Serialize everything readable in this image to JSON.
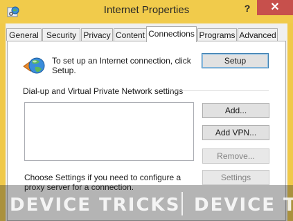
{
  "window": {
    "title": "Internet Properties",
    "help_glyph": "?",
    "close_glyph": "✕"
  },
  "tabs": [
    {
      "label": "General"
    },
    {
      "label": "Security"
    },
    {
      "label": "Privacy"
    },
    {
      "label": "Content"
    },
    {
      "label": "Connections",
      "active": true
    },
    {
      "label": "Programs"
    },
    {
      "label": "Advanced"
    }
  ],
  "setup": {
    "text": "To set up an Internet connection, click Setup.",
    "button": "Setup",
    "icon": "globe-network-icon"
  },
  "dialup": {
    "group_label": "Dial-up and Virtual Private Network settings",
    "add": "Add...",
    "add_vpn": "Add VPN...",
    "remove": "Remove...",
    "settings": "Settings",
    "connections": []
  },
  "proxy": {
    "text": "Choose Settings if you need to configure a proxy server for a connection."
  },
  "watermark": {
    "left": "DEVICE TRICKS",
    "right": "DEVICE T"
  },
  "colors": {
    "titlebar": "#f1cb4b",
    "close": "#c7504c",
    "panel": "#ffffff"
  }
}
